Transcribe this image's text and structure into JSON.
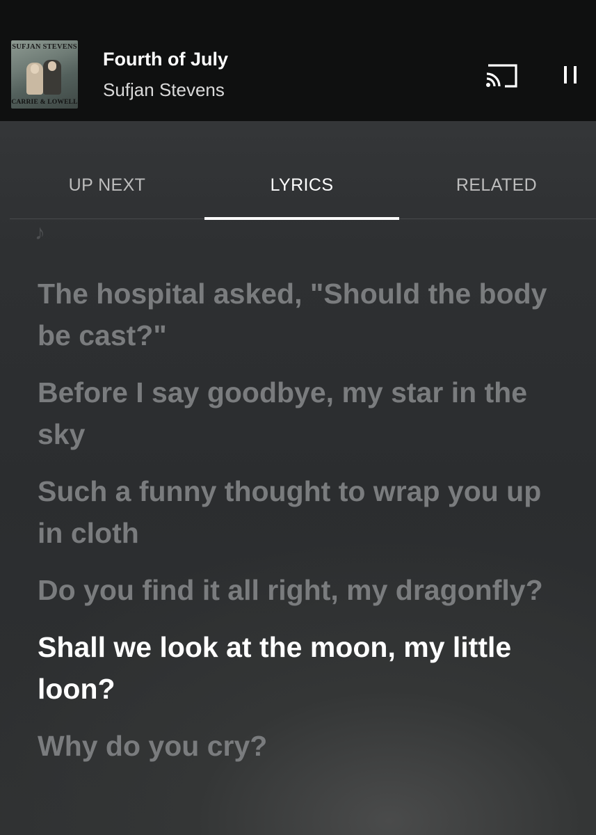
{
  "player": {
    "album_art": {
      "top_text": "SUFJAN STEVENS",
      "bottom_text": "CARRIE & LOWELL"
    },
    "title": "Fourth of July",
    "artist": "Sufjan Stevens",
    "cast_icon": "cast-icon",
    "pause_icon": "pause-icon"
  },
  "tabs": [
    {
      "label": "UP NEXT",
      "active": false
    },
    {
      "label": "LYRICS",
      "active": true
    },
    {
      "label": "RELATED",
      "active": false
    }
  ],
  "lyrics": {
    "note_icon": "♪",
    "lines": [
      "The hospital asked, \"Should the body be cast?\"",
      "Before I say goodbye, my star in the sky",
      "Such a funny thought to wrap you up in cloth",
      "Do you find it all right, my dragonfly?",
      "Shall we look at the moon, my little loon?",
      "Why do you cry?"
    ],
    "current_index": 4
  },
  "colors": {
    "header_bg": "#0f1010",
    "inactive_lyric": "#7a7c7e",
    "active_lyric": "#ffffff"
  }
}
